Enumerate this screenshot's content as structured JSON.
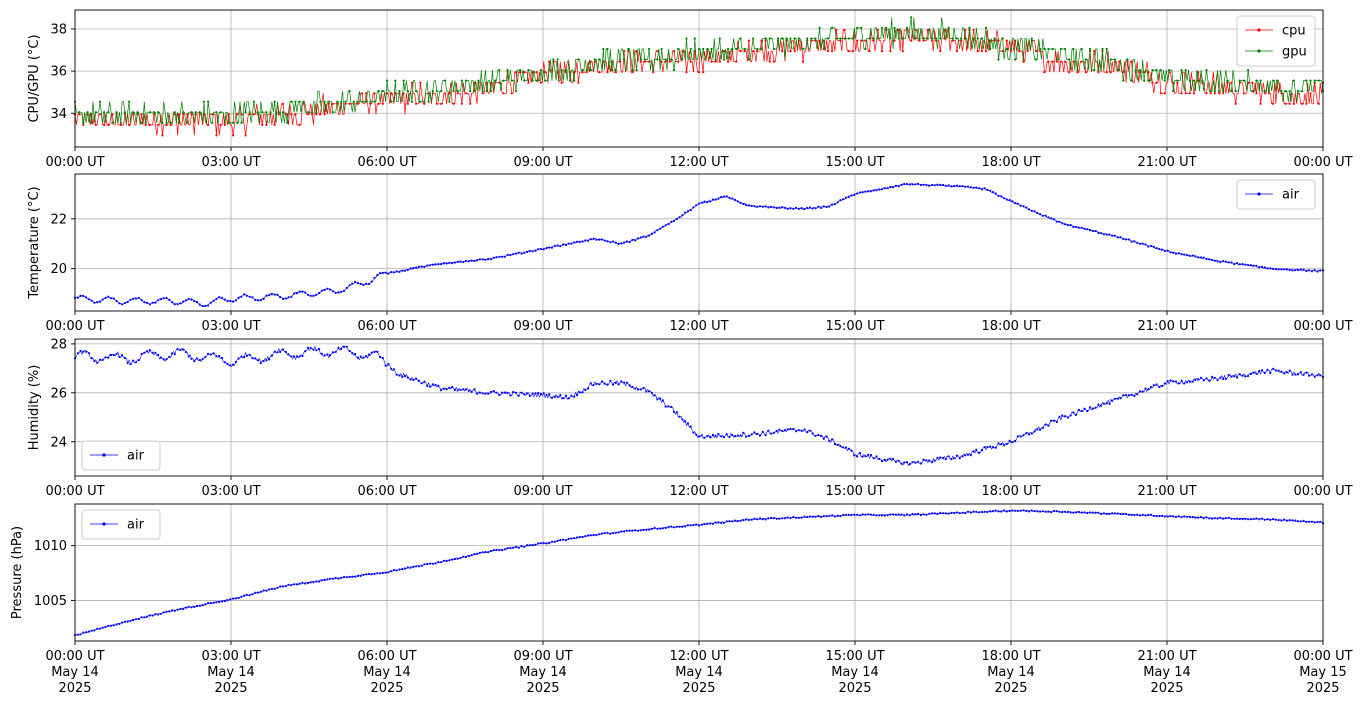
{
  "chart_data": [
    {
      "type": "line",
      "ylabel": "CPU/GPU (°C)",
      "ylim": [
        32.4,
        38.9
      ],
      "yticks": [
        34,
        36,
        38
      ],
      "xlim_hours": [
        0,
        24
      ],
      "grid": true,
      "legend": "top-right",
      "series": [
        {
          "name": "cpu",
          "color": "#ff0000",
          "x_hours": [
            0,
            1,
            2,
            3,
            4,
            5,
            6,
            7,
            8,
            9,
            10,
            11,
            12,
            13,
            14,
            15,
            16,
            17,
            18,
            19,
            20,
            21,
            22,
            23,
            24
          ],
          "values": [
            33.7,
            33.7,
            33.7,
            33.7,
            34.0,
            34.3,
            34.7,
            34.9,
            35.2,
            35.9,
            36.3,
            36.5,
            36.6,
            36.9,
            37.2,
            37.4,
            37.6,
            37.5,
            37.2,
            36.5,
            36.4,
            35.5,
            35.3,
            35.0,
            34.8
          ]
        },
        {
          "name": "gpu",
          "color": "#008000",
          "x_hours": [
            0,
            1,
            2,
            3,
            4,
            5,
            6,
            7,
            8,
            9,
            10,
            11,
            12,
            13,
            14,
            15,
            16,
            17,
            18,
            19,
            20,
            21,
            22,
            23,
            24
          ],
          "values": [
            33.8,
            33.8,
            33.8,
            33.8,
            34.2,
            34.3,
            34.8,
            35.1,
            35.4,
            35.8,
            36.4,
            36.5,
            36.8,
            37.0,
            37.3,
            37.6,
            37.8,
            37.7,
            37.1,
            36.7,
            36.3,
            35.6,
            35.4,
            35.2,
            35.2
          ]
        }
      ]
    },
    {
      "type": "line",
      "ylabel": "Temperature (°C)",
      "ylim": [
        18.3,
        23.8
      ],
      "yticks": [
        20,
        22
      ],
      "xlim_hours": [
        0,
        24
      ],
      "grid": true,
      "legend": "top-right",
      "series": [
        {
          "name": "air",
          "color": "#0000ff",
          "x_hours": [
            0,
            1,
            2,
            2.5,
            3,
            4,
            5,
            5.5,
            6,
            7,
            8,
            9,
            10,
            10.5,
            11,
            11.5,
            12,
            12.5,
            13,
            14,
            14.5,
            15,
            16,
            17,
            17.5,
            18,
            19,
            20,
            21,
            22,
            23,
            24
          ],
          "values": [
            18.8,
            18.7,
            18.7,
            18.6,
            18.8,
            18.9,
            19.1,
            19.4,
            19.8,
            20.2,
            20.4,
            20.8,
            21.2,
            21.0,
            21.3,
            21.9,
            22.6,
            22.9,
            22.5,
            22.4,
            22.5,
            23.0,
            23.4,
            23.3,
            23.2,
            22.7,
            21.8,
            21.3,
            20.7,
            20.3,
            20.0,
            19.9
          ]
        }
      ]
    },
    {
      "type": "line",
      "ylabel": "Humidity (%)",
      "ylim": [
        22.6,
        28.2
      ],
      "yticks": [
        24,
        26,
        28
      ],
      "xlim_hours": [
        0,
        24
      ],
      "grid": true,
      "legend": "bottom-left",
      "series": [
        {
          "name": "air",
          "color": "#0000ff",
          "x_hours": [
            0,
            1,
            2,
            3,
            4,
            5,
            5.8,
            6.2,
            7,
            8,
            9,
            9.5,
            10,
            10.5,
            11,
            11.5,
            12,
            13,
            14,
            14.5,
            15,
            16,
            17,
            18,
            19,
            20,
            21,
            22,
            23,
            24
          ],
          "values": [
            27.5,
            27.4,
            27.6,
            27.3,
            27.6,
            27.7,
            27.5,
            26.8,
            26.2,
            26.0,
            25.9,
            25.8,
            26.4,
            26.4,
            26.1,
            25.3,
            24.2,
            24.3,
            24.5,
            24.1,
            23.5,
            23.1,
            23.4,
            24.0,
            25.0,
            25.7,
            26.4,
            26.6,
            26.9,
            26.7
          ]
        }
      ]
    },
    {
      "type": "line",
      "ylabel": "Pressure (hPa)",
      "ylim": [
        1001.3,
        1013.8
      ],
      "yticks": [
        1005,
        1010
      ],
      "xlim_hours": [
        0,
        24
      ],
      "grid": true,
      "legend": "top-left",
      "series": [
        {
          "name": "air",
          "color": "#0000ff",
          "x_hours": [
            0,
            1,
            2,
            3,
            4,
            5,
            6,
            7,
            8,
            9,
            10,
            11,
            12,
            13,
            14,
            15,
            16,
            17,
            18,
            19,
            20,
            21,
            22,
            23,
            24
          ],
          "values": [
            1001.8,
            1003.1,
            1004.2,
            1005.1,
            1006.3,
            1007.0,
            1007.6,
            1008.5,
            1009.5,
            1010.2,
            1011.0,
            1011.5,
            1011.9,
            1012.4,
            1012.6,
            1012.8,
            1012.8,
            1013.0,
            1013.2,
            1013.1,
            1012.9,
            1012.7,
            1012.5,
            1012.4,
            1012.1
          ]
        }
      ]
    }
  ],
  "x_axis": {
    "time_labels": [
      "00:00 UT",
      "03:00 UT",
      "06:00 UT",
      "09:00 UT",
      "12:00 UT",
      "15:00 UT",
      "18:00 UT",
      "21:00 UT",
      "00:00 UT"
    ],
    "date_labels": [
      "May 14",
      "May 14",
      "May 14",
      "May 14",
      "May 14",
      "May 14",
      "May 14",
      "May 14",
      "May 15"
    ],
    "year_labels": [
      "2025",
      "2025",
      "2025",
      "2025",
      "2025",
      "2025",
      "2025",
      "2025",
      "2025"
    ]
  }
}
